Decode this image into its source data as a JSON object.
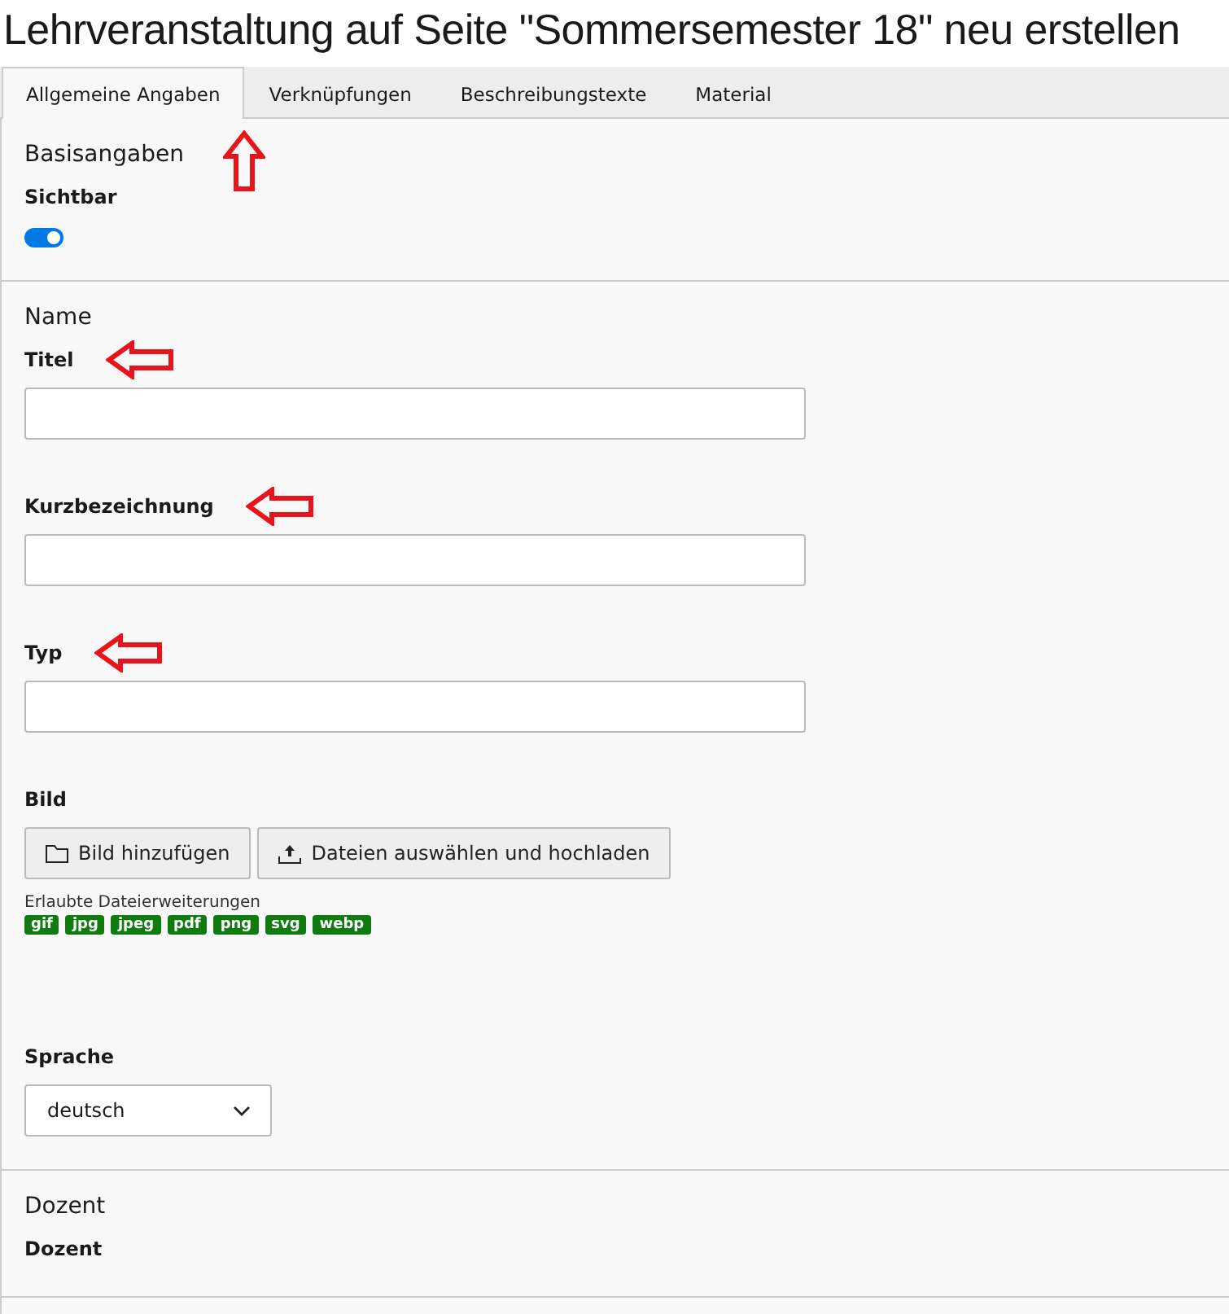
{
  "title": "Lehrveranstaltung auf Seite \"Sommersemester 18\" neu erstellen",
  "tabs": [
    {
      "label": "Allgemeine Angaben",
      "selected": true,
      "arrow": true
    },
    {
      "label": "Verknüpfungen",
      "selected": false,
      "arrow": false
    },
    {
      "label": "Beschreibungstexte",
      "selected": false,
      "arrow": false
    },
    {
      "label": "Material",
      "selected": false,
      "arrow": false
    }
  ],
  "sections": [
    {
      "heading": "Basisangaben",
      "fields": [
        {
          "kind": "toggle",
          "label": "Sichtbar",
          "on": true,
          "arrow": false
        }
      ]
    },
    {
      "heading": "Name",
      "fields": [
        {
          "kind": "text",
          "label": "Titel",
          "arrow": true
        },
        {
          "kind": "text",
          "label": "Kurzbezeichnung",
          "arrow": true
        },
        {
          "kind": "text",
          "label": "Typ",
          "arrow": true
        },
        {
          "kind": "files",
          "label": "Bild",
          "arrow": false,
          "buttons": [
            {
              "label": "Bild hinzufügen"
            },
            {
              "label": "Dateien auswählen und hochladen"
            }
          ],
          "hint": "Erlaubte Dateierweiterungen",
          "extensions": [
            "gif",
            "jpg",
            "jpeg",
            "pdf",
            "png",
            "svg",
            "webp"
          ]
        },
        {
          "kind": "select",
          "label": "Sprache",
          "arrow": false,
          "value": "deutsch"
        }
      ]
    },
    {
      "heading": "Dozent",
      "fields": [
        {
          "kind": "label",
          "label": "Dozent",
          "arrow": false
        }
      ]
    }
  ]
}
